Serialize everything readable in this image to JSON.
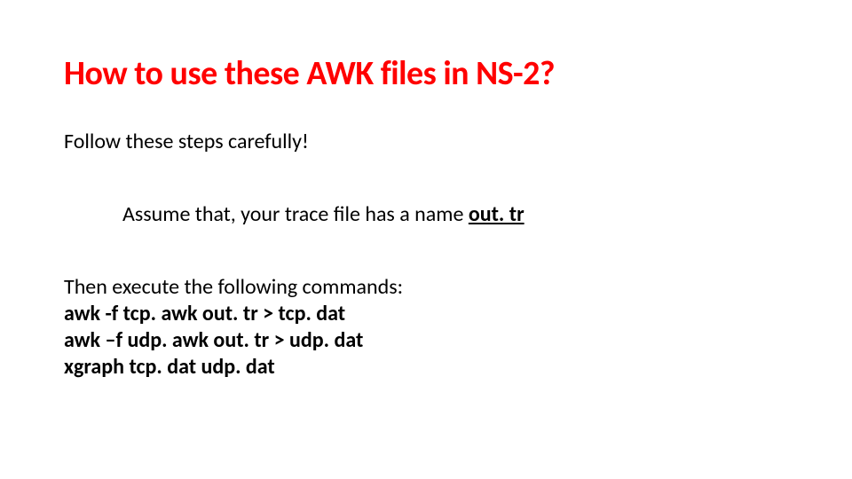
{
  "title": "How to use these AWK files in NS-2?",
  "intro": "Follow these steps carefully!",
  "assume_prefix": "Assume that, your trace file has a name ",
  "assume_name": "out. tr",
  "then_label": "Then execute the following commands:",
  "commands": {
    "c1": "awk -f tcp. awk out. tr > tcp. dat",
    "c2": "awk  –f  udp. awk  out. tr > udp. dat",
    "c3": "xgraph tcp. dat udp. dat"
  }
}
